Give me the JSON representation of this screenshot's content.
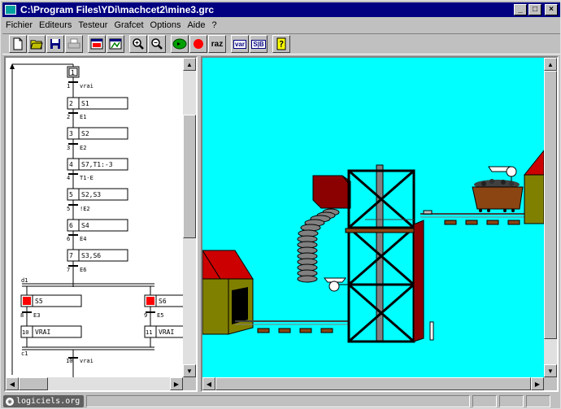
{
  "window": {
    "title": "C:\\Program Files\\YDi\\machcet2\\mine3.grc"
  },
  "title_buttons": {
    "minimize": "_",
    "maximize": "□",
    "close": "×"
  },
  "menu": {
    "items": [
      "Fichier",
      "Editeurs",
      "Testeur",
      "Grafcet",
      "Options",
      "Aide",
      "?"
    ]
  },
  "toolbar": {
    "raz_label": "raz",
    "var_label": "var",
    "table_label": "S|B"
  },
  "grafcet": {
    "steps": [
      {
        "step": "1",
        "action": ""
      },
      {
        "step": "2",
        "action": "S1"
      },
      {
        "step": "3",
        "action": "S2"
      },
      {
        "step": "4",
        "action": "S7,T1:-3"
      },
      {
        "step": "5",
        "action": "S2,S3"
      },
      {
        "step": "6",
        "action": "S4"
      },
      {
        "step": "7",
        "action": "S3,S6"
      }
    ],
    "transitions": [
      {
        "num": "1",
        "cond": "vrai"
      },
      {
        "num": "2",
        "cond": "E1"
      },
      {
        "num": "3",
        "cond": "E2"
      },
      {
        "num": "4",
        "cond": "T1-E"
      },
      {
        "num": "5",
        "cond": "!E2"
      },
      {
        "num": "6",
        "cond": "E4"
      },
      {
        "num": "7",
        "cond": "E6"
      }
    ],
    "divergence_label": "d1",
    "convergence_label": "c1",
    "branches": [
      {
        "step": "8",
        "action": "S5",
        "trans_num": "8",
        "trans_cond": "E3",
        "step2": "10",
        "action2": "VRAI"
      },
      {
        "step": "9",
        "action": "S6",
        "trans_num": "9",
        "trans_cond": "E5",
        "step2": "11",
        "action2": "VRAI"
      }
    ],
    "final_transition": {
      "num": "10",
      "cond": "vrai"
    }
  },
  "status": {
    "logo_text": "logiciels.org"
  },
  "colors": {
    "sky": "#00ffff",
    "title_bar": "#000080",
    "active_step": "#ff0000",
    "building_red": "#cc0000",
    "building_olive": "#808000",
    "tower_red": "#8b0000"
  }
}
